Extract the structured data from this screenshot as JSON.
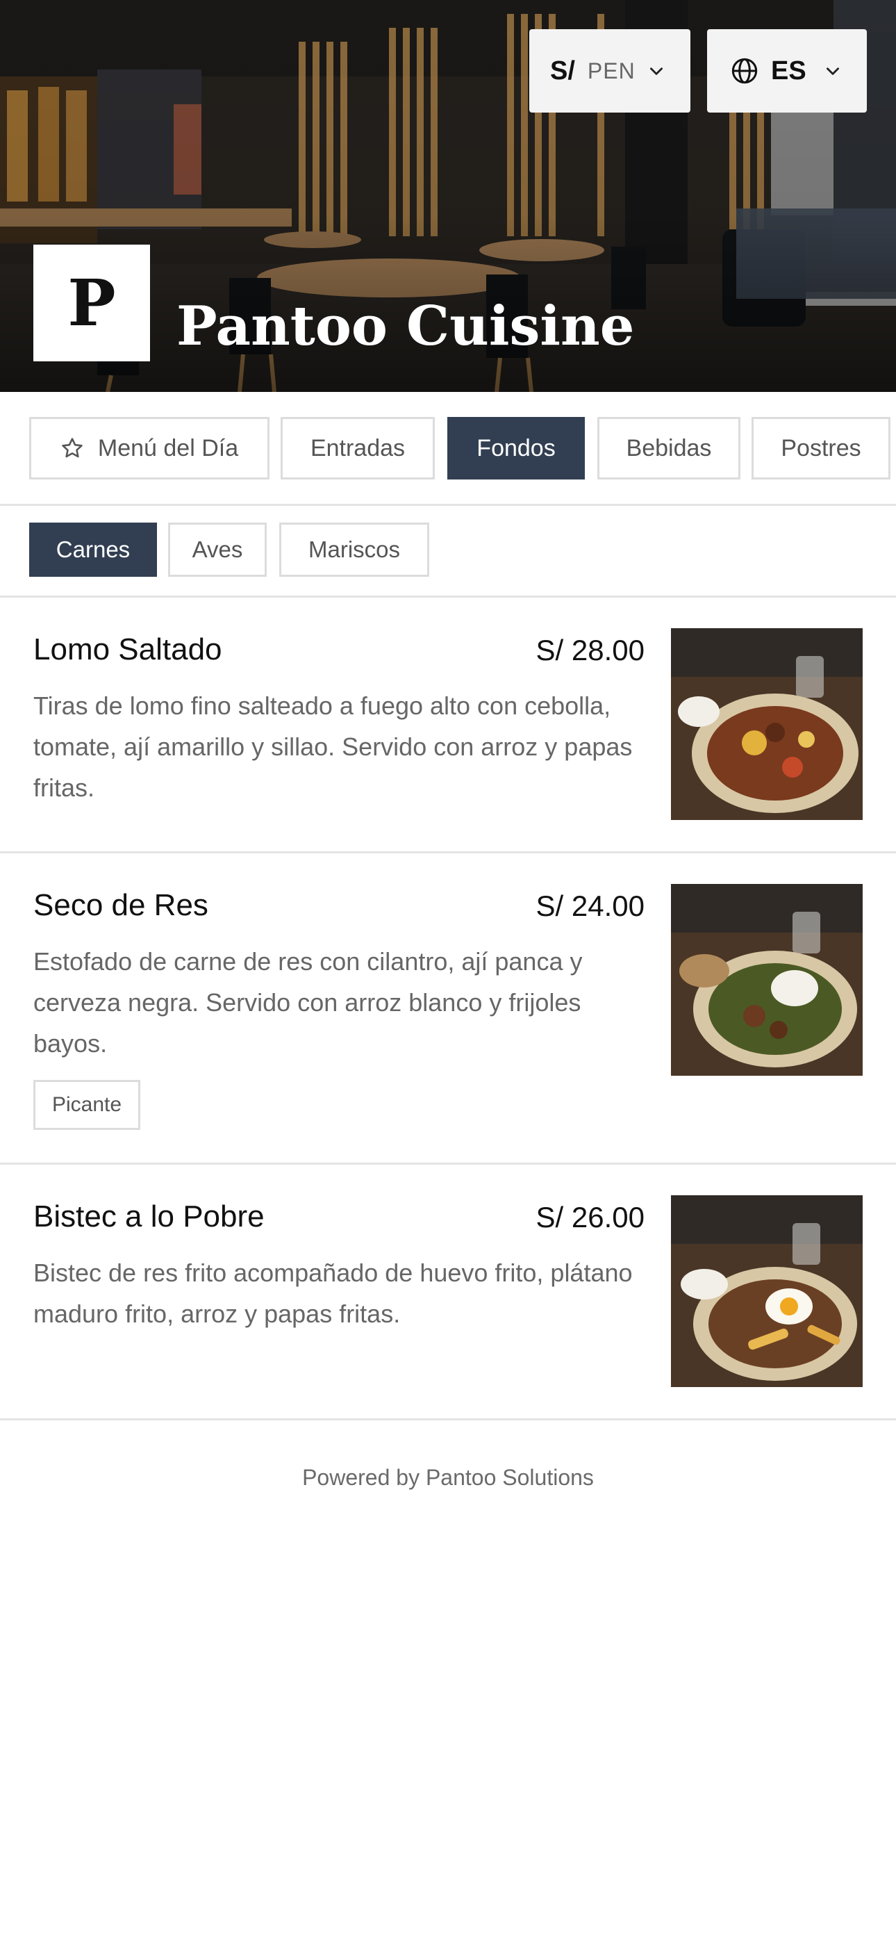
{
  "header": {
    "restaurant_name": "Pantoo Cuisine",
    "logo_letter": "P",
    "currency": {
      "symbol": "S/",
      "code": "PEN",
      "icon": "chevron-down-icon"
    },
    "language": {
      "code": "ES",
      "icon": "globe-icon"
    }
  },
  "categories": [
    {
      "label": "Menú del Día",
      "icon": "star-icon",
      "active": false
    },
    {
      "label": "Entradas",
      "active": false
    },
    {
      "label": "Fondos",
      "active": true
    },
    {
      "label": "Bebidas",
      "active": false
    },
    {
      "label": "Postres",
      "active": false
    }
  ],
  "subcategories": [
    {
      "label": "Carnes",
      "active": true
    },
    {
      "label": "Aves",
      "active": false
    },
    {
      "label": "Mariscos",
      "active": false
    }
  ],
  "dishes": [
    {
      "name": "Lomo Saltado",
      "price": "S/ 28.00",
      "description": "Tiras de lomo fino salteado a fuego alto con cebolla, tomate, ají amarillo y sillao. Servido con arroz y papas fritas."
    },
    {
      "name": "Seco de Res",
      "price": "S/ 24.00",
      "description": "Estofado de carne de res con cilantro, ají panca y cerveza negra. Servido con arroz blanco y frijoles bayos.",
      "tag": "Picante"
    },
    {
      "name": "Bistec a lo Pobre",
      "price": "S/ 26.00",
      "description": "Bistec de res frito acompañado de huevo frito, plátano maduro frito, arroz y papas fritas."
    }
  ],
  "footer": {
    "text": "Powered by Pantoo Solutions"
  },
  "colors": {
    "accent": "#323f52",
    "border": "#dcdcdc",
    "text_muted": "#666666"
  }
}
